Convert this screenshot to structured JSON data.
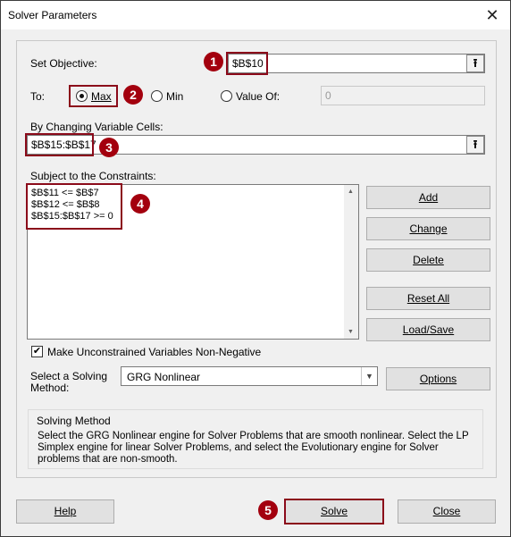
{
  "window": {
    "title": "Solver Parameters",
    "close_glyph": "✕"
  },
  "objective": {
    "label": "Set Objective:",
    "value": "$B$10"
  },
  "to": {
    "label": "To:",
    "options": [
      {
        "label": "Max",
        "selected": true
      },
      {
        "label": "Min",
        "selected": false
      },
      {
        "label": "Value Of:",
        "selected": false
      }
    ],
    "value_of": "0"
  },
  "changing": {
    "label": "By Changing Variable Cells:",
    "value": "$B$15:$B$17"
  },
  "constraints": {
    "label": "Subject to the Constraints:",
    "items": [
      "$B$11 <= $B$7",
      "$B$12 <= $B$8",
      "$B$15:$B$17 >= 0"
    ]
  },
  "buttons": {
    "add": "Add",
    "change": "Change",
    "delete": "Delete",
    "reset_all": "Reset All",
    "load_save": "Load/Save",
    "options": "Options",
    "help": "Help",
    "solve": "Solve",
    "close": "Close"
  },
  "nonneg": {
    "label": "Make Unconstrained Variables Non-Negative",
    "checked": true
  },
  "method": {
    "label_line1": "Select a Solving",
    "label_line2": "Method:",
    "value": "GRG Nonlinear"
  },
  "solving_method": {
    "title": "Solving Method",
    "text": "Select the GRG Nonlinear engine for Solver Problems that are smooth nonlinear. Select the LP Simplex engine for linear Solver Problems, and select the Evolutionary engine for Solver problems that are non-smooth."
  },
  "badges": [
    "1",
    "2",
    "3",
    "4",
    "5"
  ],
  "accent_color": "#a3000e",
  "icons": {
    "ref_button": "upload-arrow-icon",
    "dropdown": "chevron-down-icon",
    "check": "checkmark-icon"
  }
}
